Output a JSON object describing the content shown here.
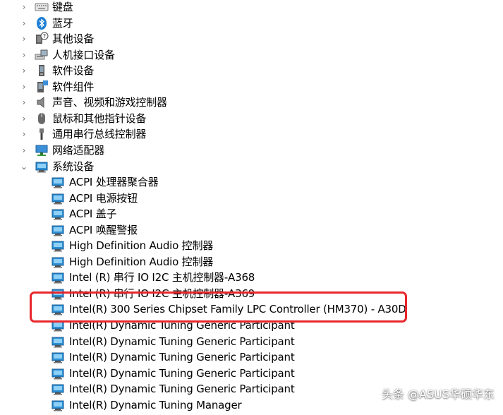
{
  "tree": {
    "categories": [
      {
        "label": "键盘",
        "expander": "›",
        "icon": "keyboard-icon"
      },
      {
        "label": "蓝牙",
        "expander": "›",
        "icon": "bluetooth-icon"
      },
      {
        "label": "其他设备",
        "expander": "›",
        "icon": "unknown-device-icon"
      },
      {
        "label": "人机接口设备",
        "expander": "›",
        "icon": "hid-icon"
      },
      {
        "label": "软件设备",
        "expander": "›",
        "icon": "software-device-icon"
      },
      {
        "label": "软件组件",
        "expander": "›",
        "icon": "software-component-icon"
      },
      {
        "label": "声音、视频和游戏控制器",
        "expander": "›",
        "icon": "speaker-icon"
      },
      {
        "label": "鼠标和其他指针设备",
        "expander": "›",
        "icon": "mouse-icon"
      },
      {
        "label": "通用串行总线控制器",
        "expander": "›",
        "icon": "usb-icon"
      },
      {
        "label": "网络适配器",
        "expander": "›",
        "icon": "network-adapter-icon"
      },
      {
        "label": "系统设备",
        "expander": "⌄",
        "icon": "system-device-icon"
      }
    ],
    "system_devices": [
      "ACPI 处理器聚合器",
      "ACPI 电源按钮",
      "ACPI 盖子",
      "ACPI 唤醒警报",
      "High Definition Audio 控制器",
      "High Definition Audio 控制器",
      "Intel (R) 串行 IO I2C 主机控制器-A368",
      "Intel (R) 串行 IO I2C 主机控制器-A369",
      "Intel(R) 300 Series Chipset Family LPC Controller (HM370) - A30D",
      "Intel(R) Dynamic Tuning Generic Participant",
      "Intel(R) Dynamic Tuning Generic Participant",
      "Intel(R) Dynamic Tuning Generic Participant",
      "Intel(R) Dynamic Tuning Generic Participant",
      "Intel(R) Dynamic Tuning Generic Participant",
      "Intel(R) Dynamic Tuning Manager"
    ]
  },
  "colors": {
    "highlight_border": "#e8262c",
    "chevron": "#6a6a6a",
    "device_icon_blue": "#2d8fd5"
  },
  "watermark": "头条 @ASUS华硕华东"
}
